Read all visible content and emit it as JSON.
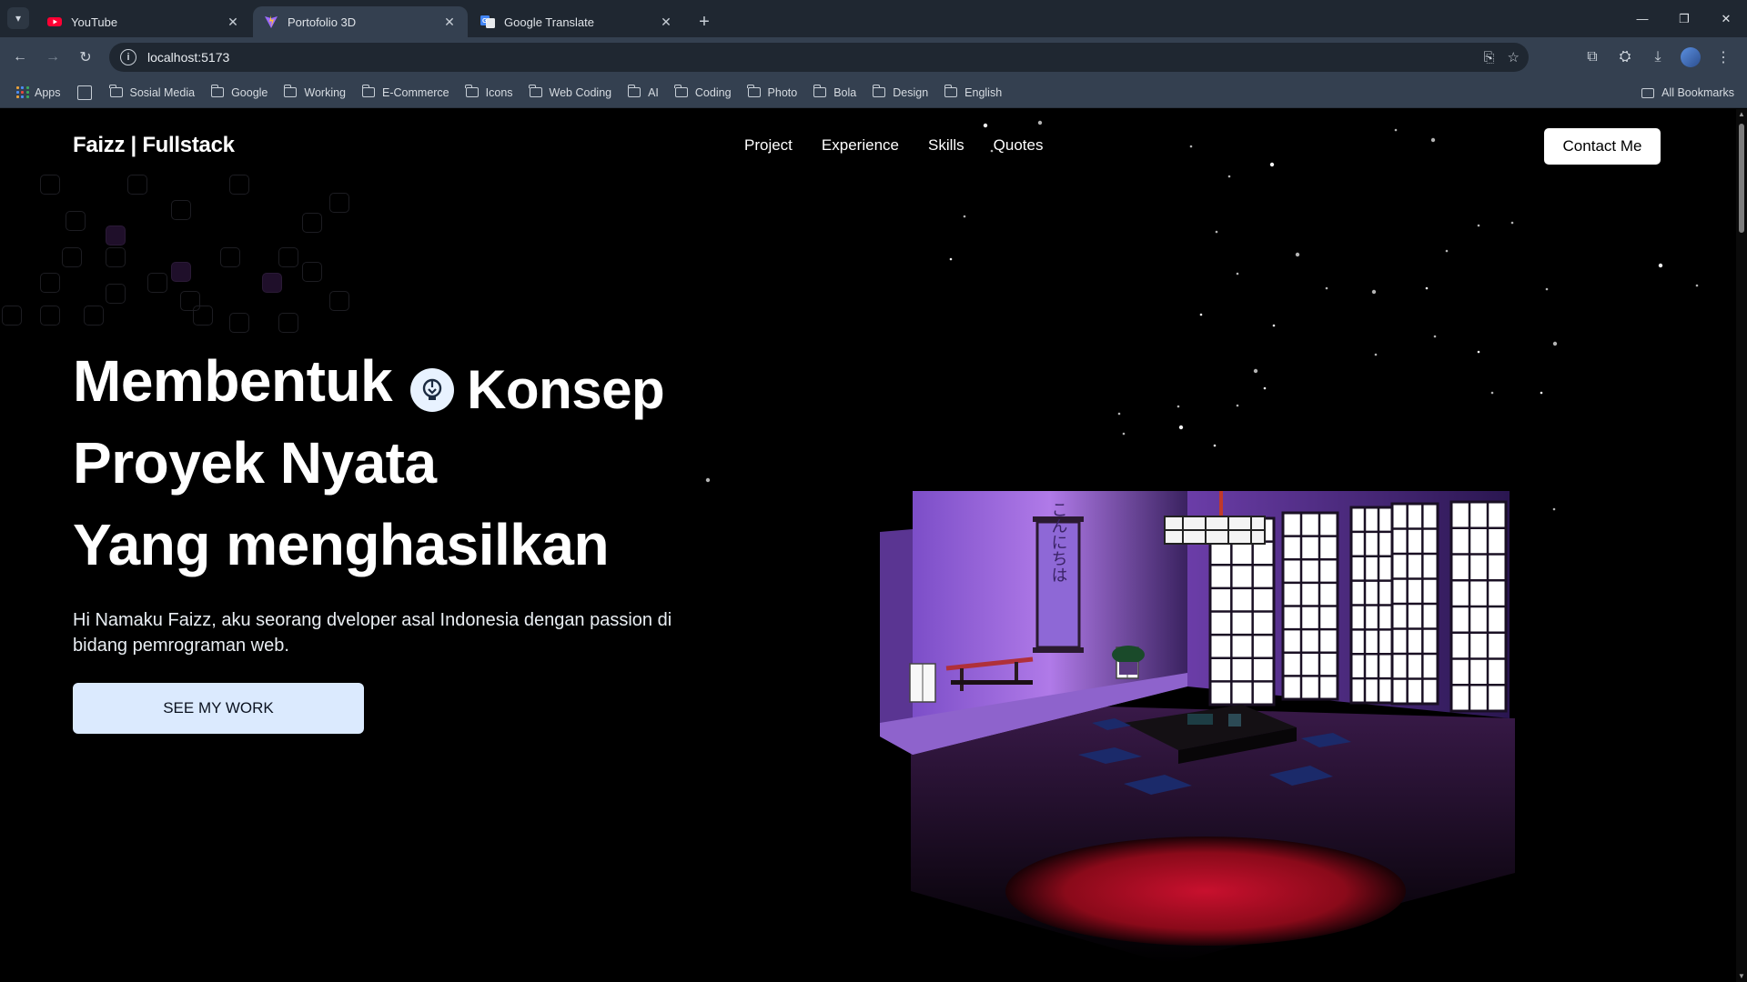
{
  "browser": {
    "tabs": [
      {
        "title": "YouTube",
        "active": false
      },
      {
        "title": "Portofolio 3D",
        "active": true
      },
      {
        "title": "Google Translate",
        "active": false
      }
    ],
    "url": "localhost:5173",
    "bookmarks": {
      "apps_label": "Apps",
      "folders": [
        "Sosial Media",
        "Google",
        "Working",
        "E-Commerce",
        "Icons",
        "Web Coding",
        "AI",
        "Coding",
        "Photo",
        "Bola",
        "Design",
        "English"
      ],
      "all_label": "All Bookmarks"
    }
  },
  "site": {
    "brand": "Faizz | Fullstack",
    "nav": [
      "Project",
      "Experience",
      "Skills",
      "Quotes"
    ],
    "contact_label": "Contact Me",
    "hero": {
      "line1": "Membentuk",
      "rotating_word": "Konsep",
      "line2": "Proyek Nyata",
      "line3": "Yang menghasilkan",
      "subtitle": "Hi Namaku Faizz, aku seorang dveloper asal Indonesia dengan passion di bidang pemrograman web.",
      "cta_label": "SEE MY WORK"
    },
    "scroll_text": "こんにちは"
  },
  "colors": {
    "page_bg": "#000000",
    "cta_bg": "#dbeafe",
    "room_purple": "#7b4fc0",
    "tatami_red": "#8a0a1a"
  }
}
